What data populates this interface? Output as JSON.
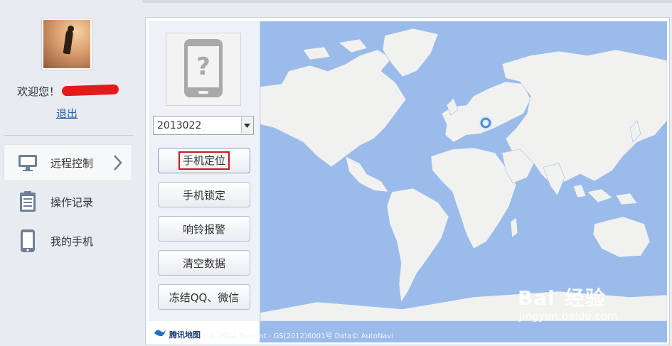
{
  "user": {
    "welcome_text": "欢迎您！",
    "logout_label": "退出"
  },
  "sidebar": {
    "items": [
      {
        "label": "远程控制",
        "icon": "monitor-icon",
        "active": true
      },
      {
        "label": "操作记录",
        "icon": "clipboard-icon",
        "active": false
      },
      {
        "label": "我的手机",
        "icon": "phone-icon",
        "active": false
      }
    ]
  },
  "device": {
    "placeholder_icon": "phone-unknown-icon",
    "selected": "2013022"
  },
  "actions": {
    "locate_label": "手机定位",
    "lock_label": "手机锁定",
    "ring_label": "响铃报警",
    "wipe_label": "清空数据",
    "freeze_label": "冻结QQ、微信"
  },
  "map": {
    "provider_label": "腾讯地图",
    "copyright": "© 2014 Tencent - GS(2012)6001号  Data© AutoNavi",
    "ocean_color": "#9bbcea",
    "land_color": "#f1f2ef"
  },
  "watermark": {
    "brand_a": "Bai",
    "brand_b": "经验",
    "url": "jingyan.baidu.com"
  },
  "colors": {
    "highlight_box": "#d0161b",
    "link": "#2b5f9e"
  }
}
